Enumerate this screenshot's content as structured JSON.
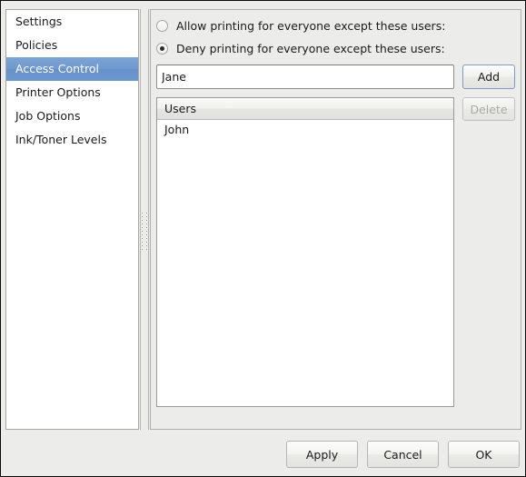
{
  "sidebar": {
    "items": [
      {
        "label": "Settings",
        "selected": false
      },
      {
        "label": "Policies",
        "selected": false
      },
      {
        "label": "Access Control",
        "selected": true
      },
      {
        "label": "Printer Options",
        "selected": false
      },
      {
        "label": "Job Options",
        "selected": false
      },
      {
        "label": "Ink/Toner Levels",
        "selected": false
      }
    ],
    "selected_color": "#6f9ad1"
  },
  "access_control": {
    "allow_option_label": "Allow printing for everyone except these users:",
    "deny_option_label": "Deny printing for everyone except these users:",
    "allow_selected": false,
    "deny_selected": true,
    "entry": {
      "value": "Jane",
      "placeholder": ""
    },
    "add_label": "Add",
    "delete_label": "Delete",
    "delete_enabled": false,
    "users_list": {
      "header": "Users",
      "rows": [
        {
          "name": "John"
        }
      ]
    }
  },
  "actions": {
    "apply_label": "Apply",
    "cancel_label": "Cancel",
    "ok_label": "OK"
  }
}
